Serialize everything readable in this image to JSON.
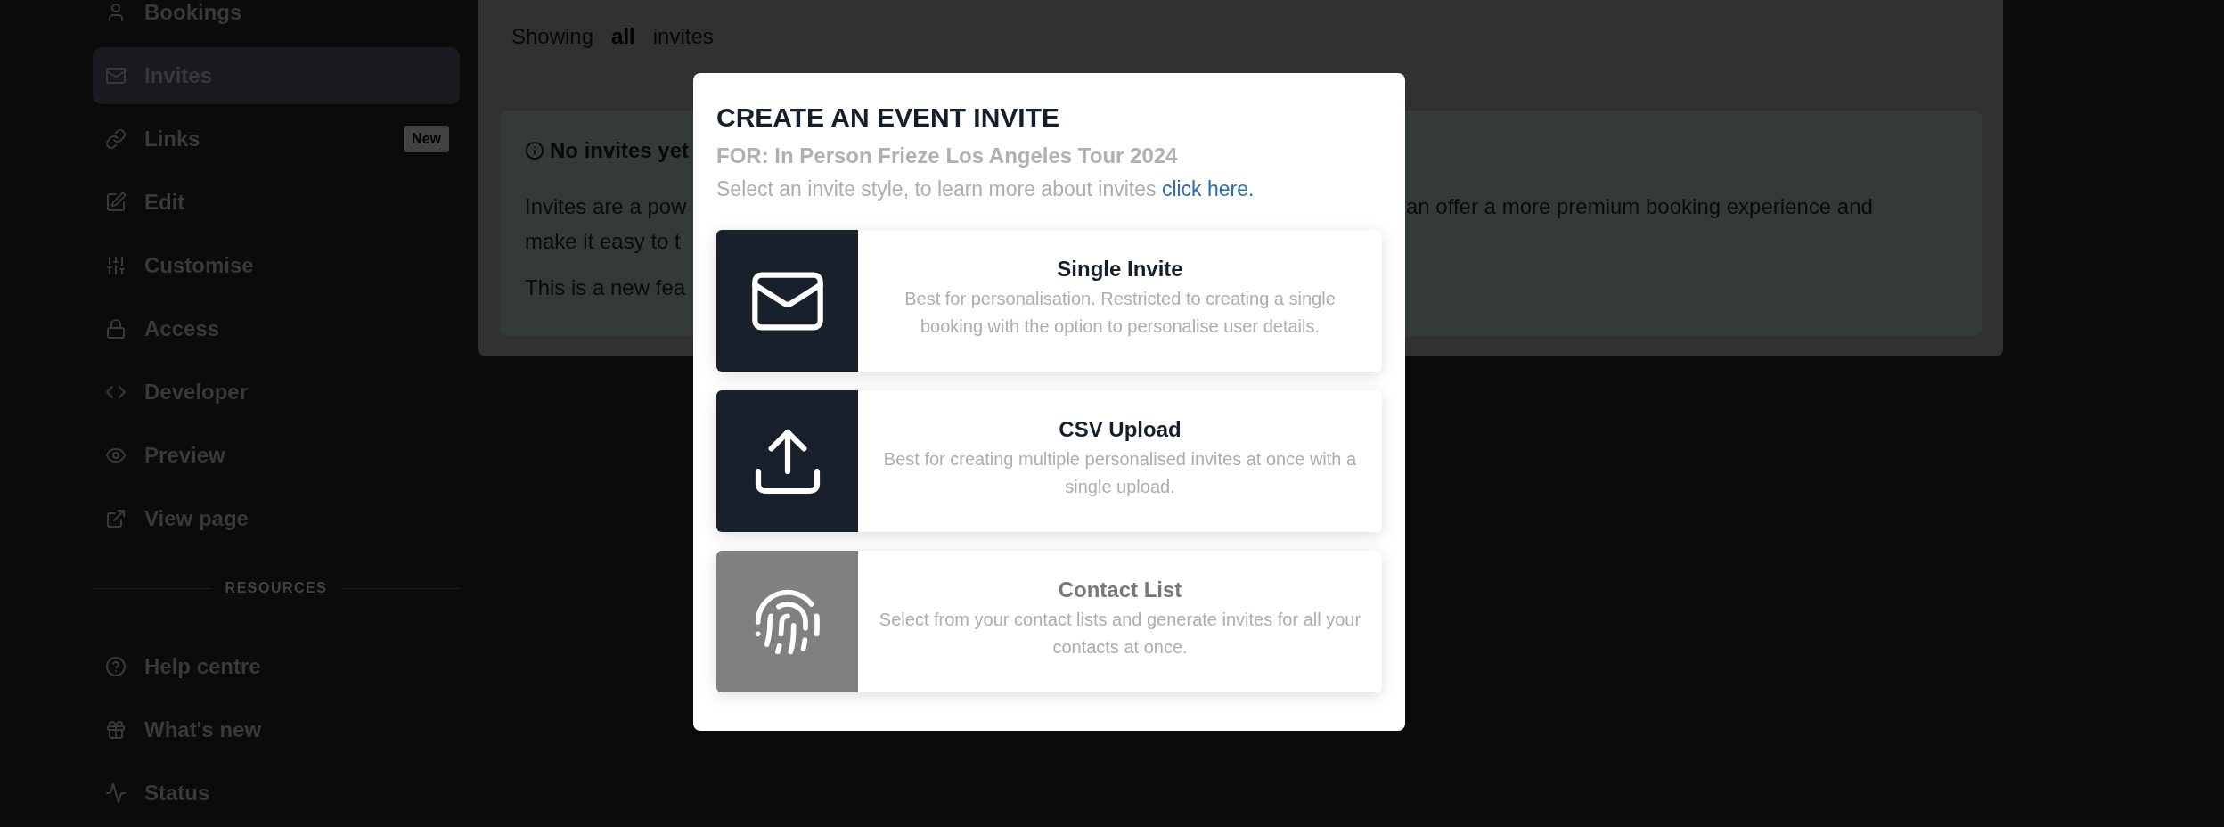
{
  "sidebar": {
    "items": [
      {
        "label": "Bookings",
        "selected": false
      },
      {
        "label": "Invites",
        "selected": true
      },
      {
        "label": "Links",
        "selected": false,
        "badge": "New"
      },
      {
        "label": "Edit",
        "selected": false
      },
      {
        "label": "Customise",
        "selected": false
      },
      {
        "label": "Access",
        "selected": false
      },
      {
        "label": "Developer",
        "selected": false
      },
      {
        "label": "Preview",
        "selected": false
      },
      {
        "label": "View page",
        "selected": false
      }
    ],
    "resources": {
      "heading": "RESOURCES",
      "items": [
        {
          "label": "Help centre",
          "selected": false
        },
        {
          "label": "What's new",
          "selected": false
        },
        {
          "label": "Status",
          "selected": false
        }
      ]
    }
  },
  "content": {
    "filter": {
      "prefix": "Showing",
      "value": "all",
      "suffix": "invites"
    },
    "notice": {
      "title": "No invites yet",
      "paragraphs": [
        {
          "left": [
            "Invites are a pow",
            "make it easy to t"
          ],
          "right": [
            "an offer a more premium booking experience and"
          ]
        },
        {
          "left": [
            "This is a new fea"
          ]
        }
      ]
    }
  },
  "modal": {
    "title": "CREATE AN EVENT INVITE",
    "subtitle": "FOR: In Person Frieze Los Angeles Tour 2024",
    "intro": "Select an invite style, to learn more about invites",
    "link": "click here.",
    "options": [
      {
        "title": "Single Invite",
        "description": "Best for personalisation. Restricted to creating a single booking with the option to personalise user details.",
        "disabled": false
      },
      {
        "title": "CSV Upload",
        "description": "Best for creating multiple personalised invites at once with a single upload.",
        "disabled": false
      },
      {
        "title": "Contact List",
        "description": "Select from your contact lists and generate invites for all your contacts at once.",
        "disabled": true
      }
    ]
  }
}
